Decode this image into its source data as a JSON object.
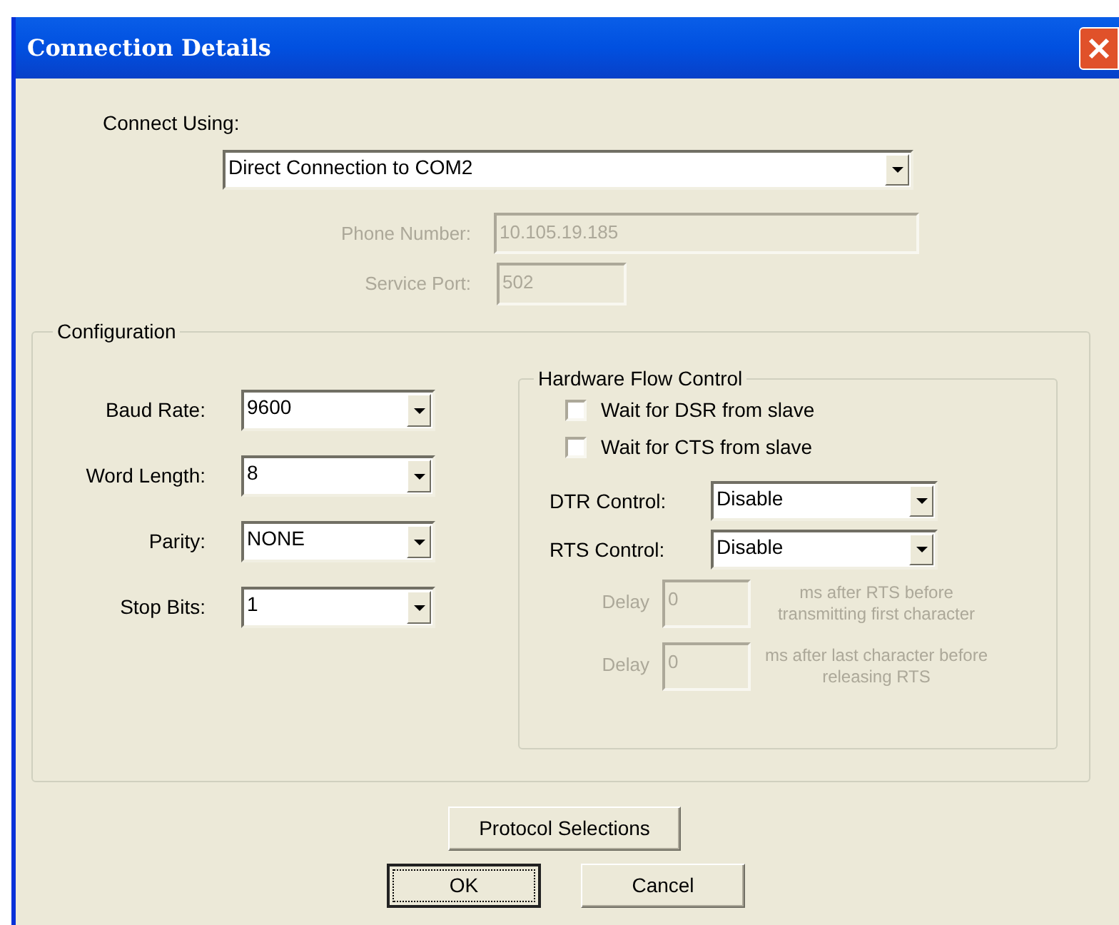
{
  "window": {
    "title": "Connection Details"
  },
  "connect_using": {
    "label": "Connect Using:",
    "value": "Direct Connection to COM2"
  },
  "phone_number": {
    "label": "Phone Number:",
    "value": "10.105.19.185",
    "disabled": true
  },
  "service_port": {
    "label": "Service Port:",
    "value": "502",
    "disabled": true
  },
  "configuration": {
    "title": "Configuration",
    "fields": [
      {
        "label": "Baud Rate:",
        "value": "9600"
      },
      {
        "label": "Word Length:",
        "value": "8"
      },
      {
        "label": "Parity:",
        "value": "NONE"
      },
      {
        "label": "Stop Bits:",
        "value": "1"
      }
    ]
  },
  "hardware_flow_control": {
    "title": "Hardware Flow Control",
    "checkboxes": [
      {
        "label": "Wait for DSR from slave",
        "checked": false
      },
      {
        "label": "Wait for CTS from slave",
        "checked": false
      }
    ],
    "controls": [
      {
        "label": "DTR Control:",
        "value": "Disable"
      },
      {
        "label": "RTS Control:",
        "value": "Disable"
      }
    ],
    "delays": [
      {
        "label": "Delay",
        "value": "0",
        "note": "ms after RTS before transmitting first character",
        "disabled": true
      },
      {
        "label": "Delay",
        "value": "0",
        "note": "ms after last character before releasing RTS",
        "disabled": true
      }
    ]
  },
  "buttons": [
    {
      "label": "Protocol Selections",
      "focused": false
    },
    {
      "label": "OK",
      "focused": true
    },
    {
      "label": "Cancel",
      "focused": false
    }
  ]
}
